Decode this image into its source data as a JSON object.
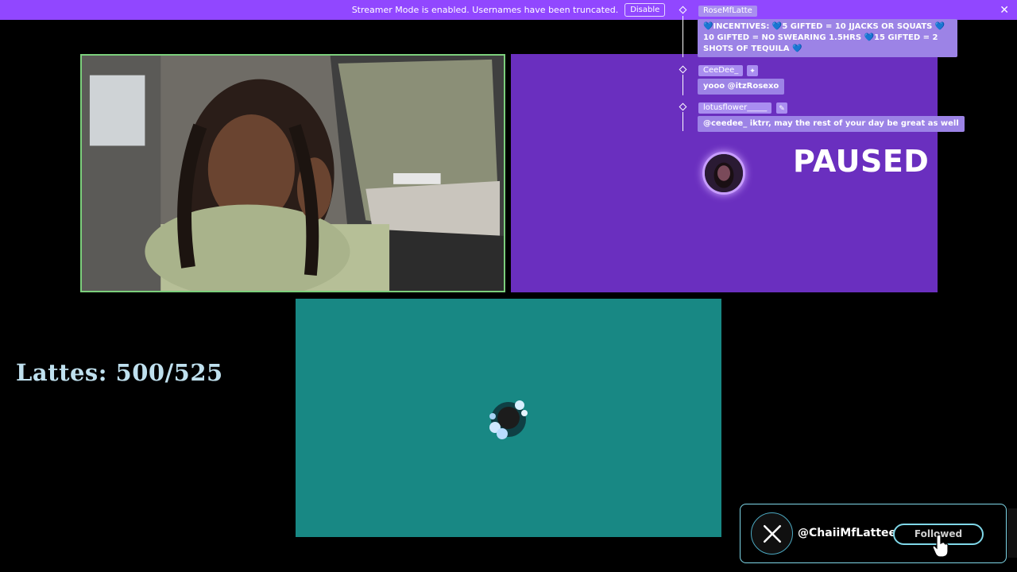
{
  "banner": {
    "text": "Streamer Mode is enabled. Usernames have been truncated.",
    "disable_label": "Disable",
    "close_icon": "close-icon"
  },
  "colors": {
    "banner": "#9147ff",
    "paused_panel": "#6a2fbf",
    "teal_panel": "#188884",
    "chat_name_bg": "#a98ef0",
    "chat_msg_bg": "#9c83e6",
    "follow_border": "#7fd7e8"
  },
  "chat": [
    {
      "user": "RoseMfLatte",
      "message": "💙INCENTIVES: 💙5 GIFTED = 10 JJACKS OR SQUATS 💙10 GIFTED = NO SWEARING 1.5HRS 💙15 GIFTED = 2 SHOTS OF TEQUILA 💙"
    },
    {
      "user": "CeeDee_",
      "message": "yooo @itzRosexo"
    },
    {
      "user": "lotusflower_____",
      "message": "@ceedee_ iktrr, may the rest of your day be great as well"
    }
  ],
  "stream": {
    "paused_label": "PAUSED"
  },
  "goal": {
    "text": "Lattes: 500/525"
  },
  "follow_widget": {
    "platform_icon": "x-logo-icon",
    "handle": "@ChaiiMfLattee",
    "button_label": "Followed"
  }
}
